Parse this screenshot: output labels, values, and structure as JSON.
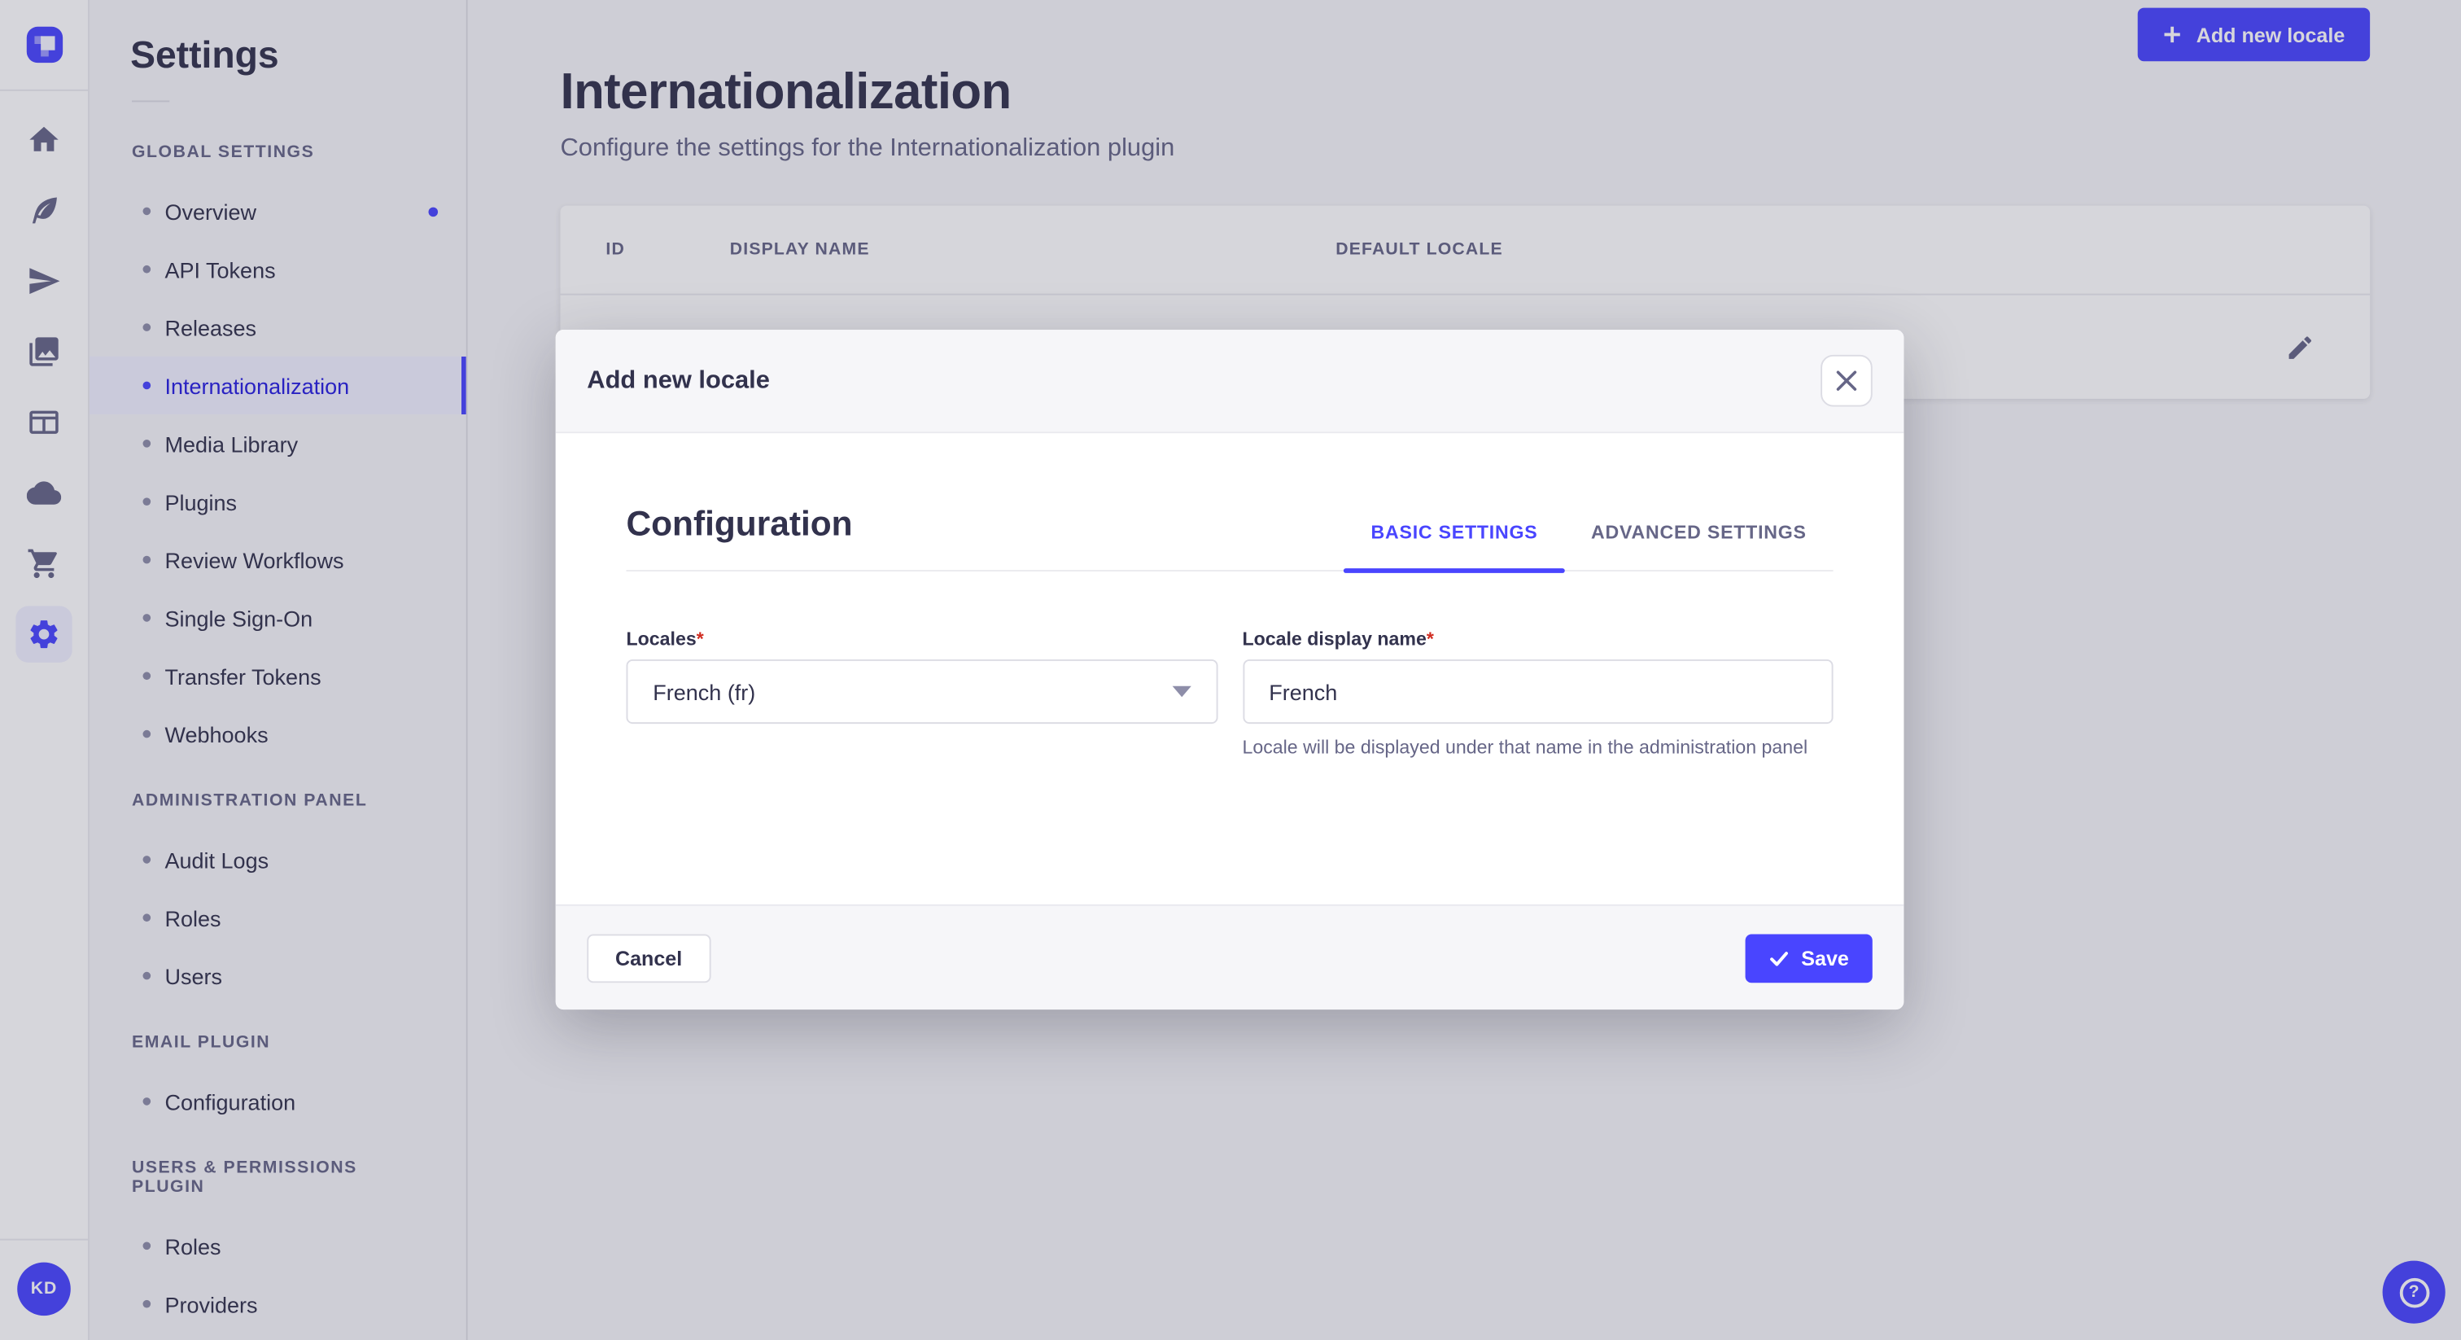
{
  "colors": {
    "primary": "#4945ff",
    "primary_light": "#f0f0ff",
    "active_link_text": "#271fe0",
    "danger": "#d02b20",
    "neutral_text": "#32324d",
    "muted_text": "#666687"
  },
  "rail": {
    "logo_icon": "strapi-logo",
    "icons": [
      "home-icon",
      "feather-icon",
      "send-icon",
      "media-library-icon",
      "layout-icon",
      "cloud-icon",
      "cart-icon",
      "gear-icon"
    ],
    "active_icon": "gear-icon",
    "avatar_initials": "KD"
  },
  "sidebar": {
    "title": "Settings",
    "sections": [
      {
        "label": "GLOBAL SETTINGS",
        "items": [
          {
            "label": "Overview",
            "notification": true
          },
          {
            "label": "API Tokens"
          },
          {
            "label": "Releases"
          },
          {
            "label": "Internationalization",
            "active": true
          },
          {
            "label": "Media Library"
          },
          {
            "label": "Plugins"
          },
          {
            "label": "Review Workflows"
          },
          {
            "label": "Single Sign-On"
          },
          {
            "label": "Transfer Tokens"
          },
          {
            "label": "Webhooks"
          }
        ]
      },
      {
        "label": "ADMINISTRATION PANEL",
        "items": [
          {
            "label": "Audit Logs"
          },
          {
            "label": "Roles"
          },
          {
            "label": "Users"
          }
        ]
      },
      {
        "label": "EMAIL PLUGIN",
        "items": [
          {
            "label": "Configuration"
          }
        ]
      },
      {
        "label": "USERS & PERMISSIONS PLUGIN",
        "items": [
          {
            "label": "Roles"
          },
          {
            "label": "Providers"
          }
        ]
      }
    ]
  },
  "main": {
    "title": "Internationalization",
    "subtitle": "Configure the settings for the Internationalization plugin",
    "add_button_label": "Add new locale",
    "table": {
      "headers": [
        "ID",
        "DISPLAY NAME",
        "DEFAULT LOCALE"
      ]
    }
  },
  "modal": {
    "title": "Add new locale",
    "section_title": "Configuration",
    "tabs": [
      {
        "label": "BASIC SETTINGS",
        "active": true
      },
      {
        "label": "ADVANCED SETTINGS",
        "active": false
      }
    ],
    "form": {
      "required_marker": "*",
      "locales_label": "Locales",
      "locales_value": "French (fr)",
      "display_name_label": "Locale display name",
      "display_name_value": "French",
      "display_name_hint": "Locale will be displayed under that name in the administration panel"
    },
    "cancel_label": "Cancel",
    "save_label": "Save"
  },
  "help": {
    "label": "?"
  }
}
